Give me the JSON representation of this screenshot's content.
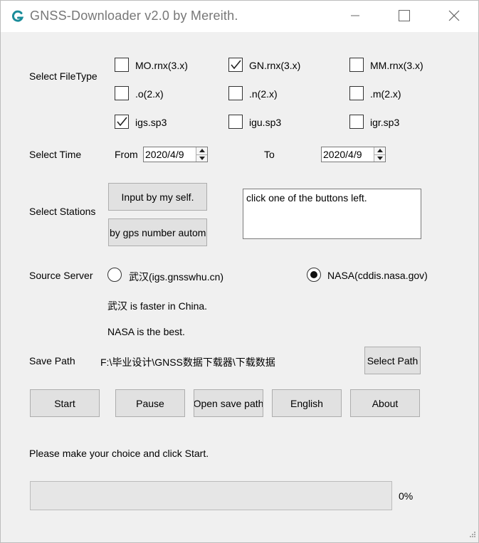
{
  "window": {
    "title": "GNSS-Downloader   v2.0 by Mereith.",
    "app_icon_letter": "G",
    "accent_color": "#1a8c9a"
  },
  "filetype": {
    "label": "Select FileType",
    "options": [
      {
        "label": "MO.rnx(3.x)",
        "checked": false
      },
      {
        "label": "GN.rnx(3.x)",
        "checked": true
      },
      {
        "label": "MM.rnx(3.x)",
        "checked": false
      },
      {
        "label": ".o(2.x)",
        "checked": false
      },
      {
        "label": ".n(2.x)",
        "checked": false
      },
      {
        "label": ".m(2.x)",
        "checked": false
      },
      {
        "label": "igs.sp3",
        "checked": true
      },
      {
        "label": "igu.sp3",
        "checked": false
      },
      {
        "label": "igr.sp3",
        "checked": false
      }
    ]
  },
  "time": {
    "label": "Select Time",
    "from_label": "From",
    "from_value": "2020/4/9",
    "to_label": "To",
    "to_value": "2020/4/9"
  },
  "stations": {
    "label": "Select Stations",
    "input_button": "Input by my self.",
    "auto_button": "by gps number autom",
    "info_text": "click one of the buttons left."
  },
  "server": {
    "label": "Source Server",
    "options": [
      {
        "label": "武汉(igs.gnsswhu.cn)",
        "selected": false
      },
      {
        "label": "NASA(cddis.nasa.gov)",
        "selected": true
      }
    ],
    "note1": "武汉 is faster in China.",
    "note2": "NASA is the best."
  },
  "save": {
    "label": "Save Path",
    "path": "F:\\毕业设计\\GNSS数据下载器\\下载数据",
    "select_button": "Select Path"
  },
  "actions": {
    "start": "Start",
    "pause": "Pause",
    "open_save": "Open save path",
    "english": "English",
    "about": "About"
  },
  "status": {
    "message": "Please make your choice and click Start.",
    "progress_percent": 0,
    "progress_text": "0%"
  }
}
